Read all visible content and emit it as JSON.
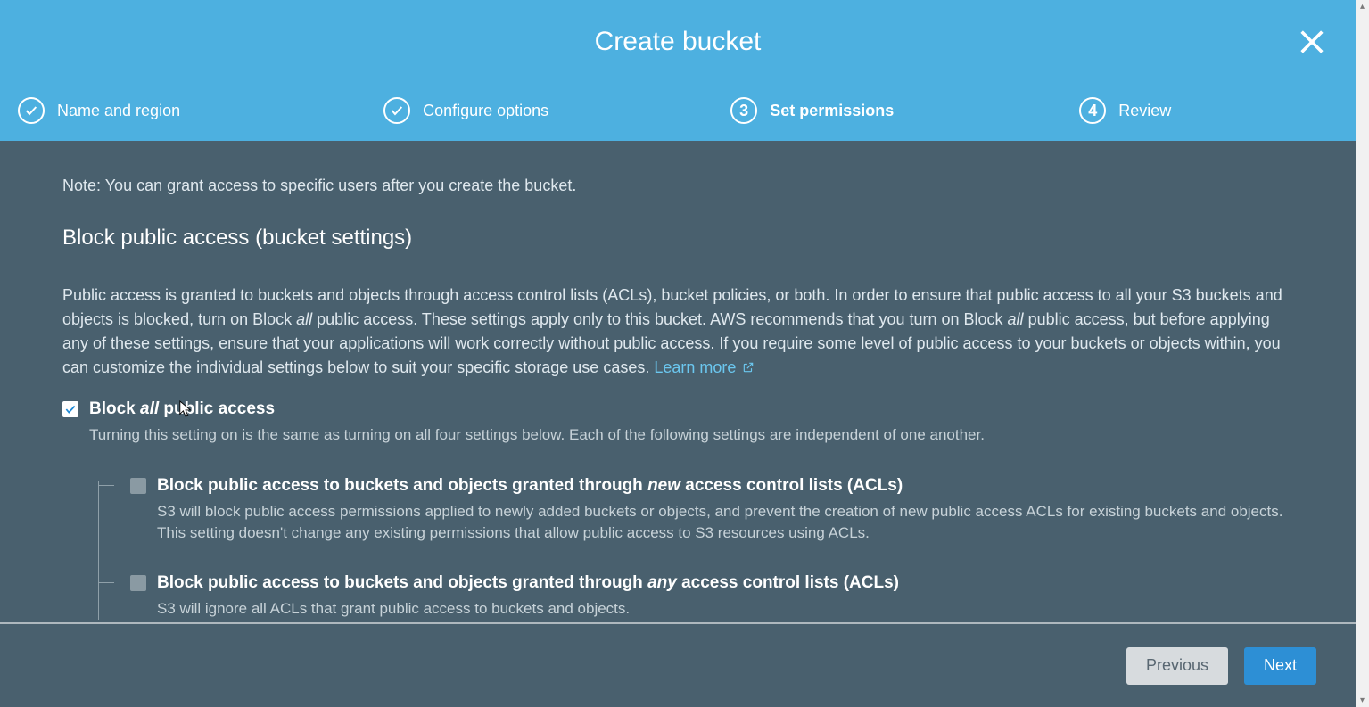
{
  "header": {
    "title": "Create bucket"
  },
  "steps": [
    {
      "label": "Name and region",
      "status": "completed"
    },
    {
      "label": "Configure options",
      "status": "completed"
    },
    {
      "label": "Set permissions",
      "status": "active",
      "num": "3"
    },
    {
      "label": "Review",
      "status": "pending",
      "num": "4"
    }
  ],
  "note": "Note: You can grant access to specific users after you create the bucket.",
  "section": {
    "title": "Block public access (bucket settings)",
    "desc_part1": "Public access is granted to buckets and objects through access control lists (ACLs), bucket policies, or both. In order to ensure that public access to all your S3 buckets and objects is blocked, turn on Block ",
    "desc_italic1": "all",
    "desc_part2": " public access. These settings apply only to this bucket. AWS recommends that you turn on Block ",
    "desc_italic2": "all",
    "desc_part3": " public access, but before applying any of these settings, ensure that your applications will work correctly without public access. If you require some level of public access to your buckets or objects within, you can customize the individual settings below to suit your specific storage use cases. ",
    "learn_more": "Learn more"
  },
  "block_all": {
    "label_pre": "Block ",
    "label_italic": "all",
    "label_post": " public access",
    "sub": "Turning this setting on is the same as turning on all four settings below. Each of the following settings are independent of one another.",
    "checked": true
  },
  "children": [
    {
      "label_pre": "Block public access to buckets and objects granted through ",
      "label_italic": "new",
      "label_post": " access control lists (ACLs)",
      "sub": "S3 will block public access permissions applied to newly added buckets or objects, and prevent the creation of new public access ACLs for existing buckets and objects. This setting doesn't change any existing permissions that allow public access to S3 resources using ACLs."
    },
    {
      "label_pre": "Block public access to buckets and objects granted through ",
      "label_italic": "any",
      "label_post": " access control lists (ACLs)",
      "sub": "S3 will ignore all ACLs that grant public access to buckets and objects."
    }
  ],
  "footer": {
    "previous": "Previous",
    "next": "Next"
  }
}
